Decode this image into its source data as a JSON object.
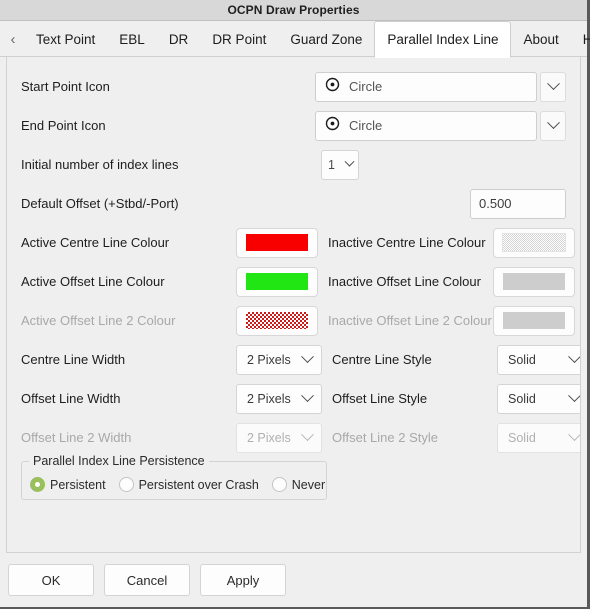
{
  "window": {
    "title": "OCPN Draw Properties"
  },
  "tabs": {
    "scroll_left_icon": "chevron-left-icon",
    "scroll_right_icon": "chevron-right-icon",
    "items": [
      {
        "label": "Text Point",
        "active": false
      },
      {
        "label": "EBL",
        "active": false
      },
      {
        "label": "DR",
        "active": false
      },
      {
        "label": "DR Point",
        "active": false
      },
      {
        "label": "Guard Zone",
        "active": false
      },
      {
        "label": "Parallel Index Line",
        "active": true
      },
      {
        "label": "About",
        "active": false
      },
      {
        "label": "Help",
        "active": false
      }
    ]
  },
  "form": {
    "start_point_icon": {
      "label": "Start Point Icon",
      "value": "Circle",
      "icon": "circle-dot-icon"
    },
    "end_point_icon": {
      "label": "End Point Icon",
      "value": "Circle",
      "icon": "circle-dot-icon"
    },
    "initial_index_lines": {
      "label": "Initial number of index lines",
      "value": "1"
    },
    "default_offset": {
      "label": "Default Offset (+Stbd/-Port)",
      "value": "0.500"
    },
    "active_centre_line_colour": {
      "label": "Active Centre Line Colour",
      "color": "#f90000",
      "enabled": true
    },
    "inactive_centre_line_colour": {
      "label": "Inactive Centre Line Colour",
      "color": "#d4d4d4",
      "enabled": true
    },
    "active_offset_line_colour": {
      "label": "Active Offset Line Colour",
      "color": "#22e614",
      "enabled": true
    },
    "inactive_offset_line_colour": {
      "label": "Inactive Offset Line Colour",
      "color": "#cdcdcd",
      "enabled": true
    },
    "active_offset_line2_colour": {
      "label": "Active Offset Line 2 Colour",
      "color": "#cf1a1a",
      "enabled": false
    },
    "inactive_offset_line2_colour": {
      "label": "Inactive Offset Line 2 Colour",
      "color": "#cdcdcd",
      "enabled": false
    },
    "centre_line_width": {
      "label": "Centre Line Width",
      "value": "2 Pixels",
      "enabled": true
    },
    "centre_line_style": {
      "label": "Centre Line Style",
      "value": "Solid",
      "enabled": true
    },
    "offset_line_width": {
      "label": "Offset Line Width",
      "value": "2 Pixels",
      "enabled": true
    },
    "offset_line_style": {
      "label": "Offset Line Style",
      "value": "Solid",
      "enabled": true
    },
    "offset_line2_width": {
      "label": "Offset Line 2 Width",
      "value": "2 Pixels",
      "enabled": false
    },
    "offset_line2_style": {
      "label": "Offset Line 2 Style",
      "value": "Solid",
      "enabled": false
    },
    "persistence": {
      "title": "Parallel Index Line Persistence",
      "selected": "Persistent",
      "accent_color": "#9ac05e",
      "options": [
        {
          "label": "Persistent",
          "checked": true
        },
        {
          "label": "Persistent over Crash",
          "checked": false
        },
        {
          "label": "Never",
          "checked": false
        }
      ]
    }
  },
  "buttons": {
    "ok": "OK",
    "cancel": "Cancel",
    "apply": "Apply"
  }
}
